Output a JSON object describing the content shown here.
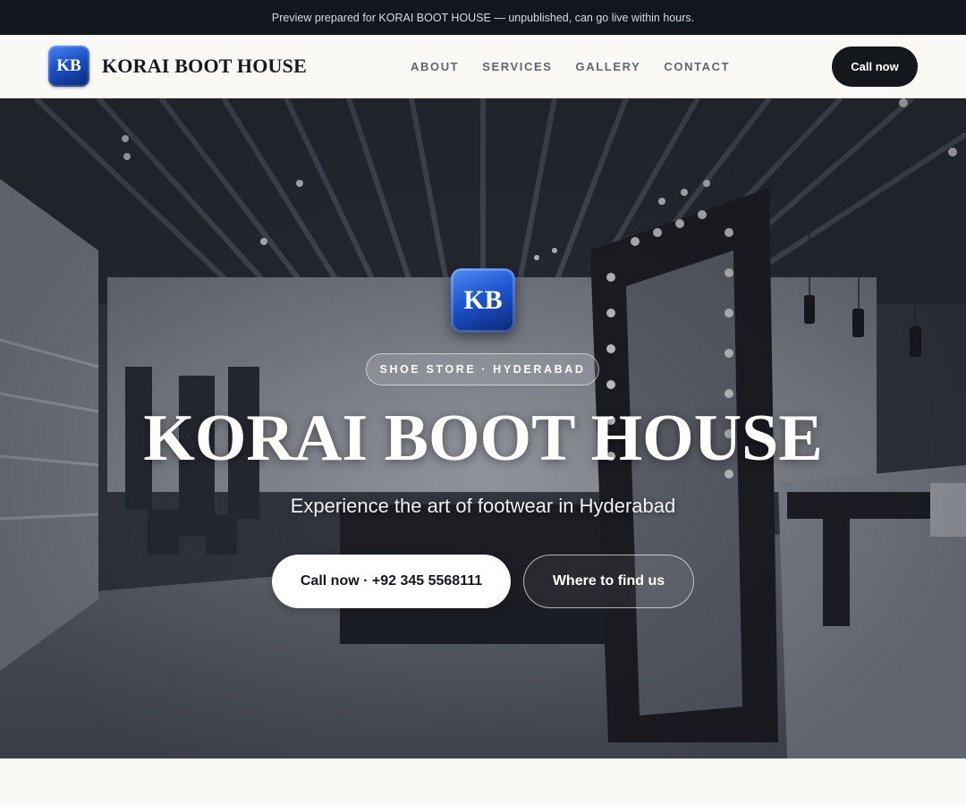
{
  "preview_banner": {
    "text": "Preview prepared for KORAI BOOT HOUSE — unpublished, can go live within hours."
  },
  "header": {
    "logo_initials": "KB",
    "brand_name": "KORAI BOOT HOUSE",
    "nav": [
      {
        "label": "ABOUT"
      },
      {
        "label": "SERVICES"
      },
      {
        "label": "GALLERY"
      },
      {
        "label": "CONTACT"
      }
    ],
    "cta_label": "Call now"
  },
  "hero": {
    "logo_initials": "KB",
    "tag": "SHOE STORE · HYDERABAD",
    "title": "KORAI BOOT HOUSE",
    "subtitle": "Experience the art of footwear in Hyderabad",
    "primary_button": "Call now · +92 345 5568111",
    "secondary_button": "Where to find us",
    "background_image": "store-interior-photo"
  },
  "colors": {
    "dark": "#14171c",
    "logo_blue": "#1d55cf",
    "page_bg": "#faf9f6"
  }
}
